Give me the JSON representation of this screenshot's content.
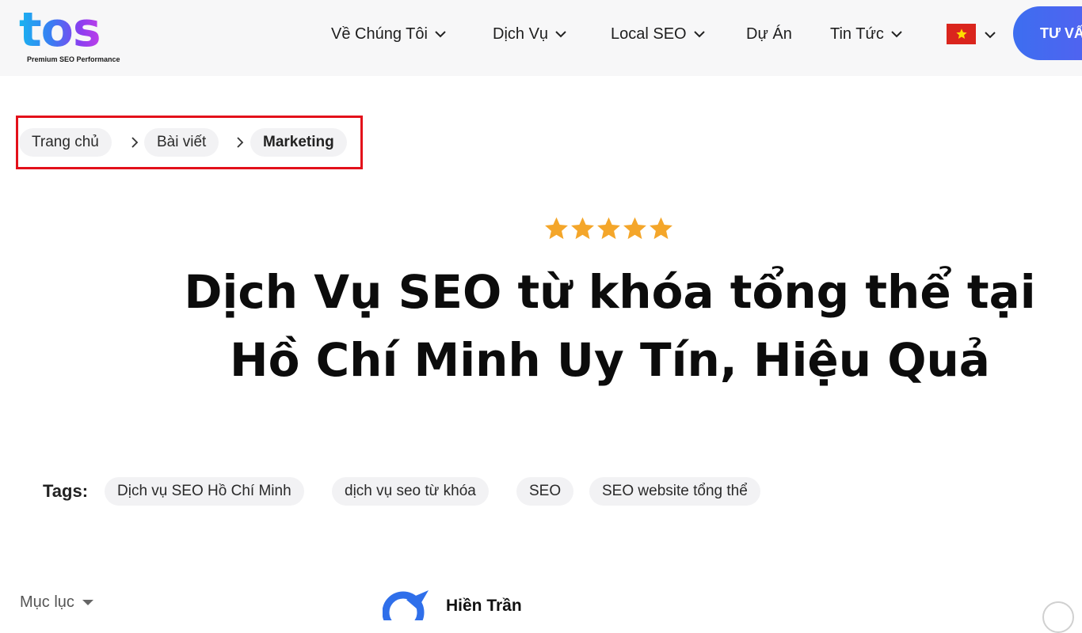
{
  "header": {
    "logo_text": "tos",
    "logo_tagline": "Premium SEO Performance",
    "nav": [
      {
        "label": "Về Chúng Tôi",
        "has_dropdown": true
      },
      {
        "label": "Dịch Vụ",
        "has_dropdown": true
      },
      {
        "label": "Local SEO",
        "has_dropdown": true
      },
      {
        "label": "Dự Án",
        "has_dropdown": false
      },
      {
        "label": "Tin Tức",
        "has_dropdown": true
      }
    ],
    "language_flag": "vietnam-flag-icon",
    "cta_label": "TƯ VẤ"
  },
  "breadcrumb": {
    "items": [
      "Trang chủ",
      "Bài viết",
      "Marketing"
    ],
    "current": "Marketing",
    "highlight_color": "#e3101a"
  },
  "rating": {
    "stars": 5,
    "max": 5,
    "color": "#f4a62a"
  },
  "article": {
    "title_line_1": "Dịch Vụ SEO từ khóa tổng thể tại",
    "title_line_2": "Hồ Chí Minh Uy Tín, Hiệu Quả"
  },
  "tags": {
    "label": "Tags:",
    "items": [
      "Dịch vụ SEO Hồ Chí Minh",
      "dịch vụ seo từ khóa",
      "SEO",
      "SEO website tổng thể"
    ]
  },
  "toc": {
    "label": "Mục lục"
  },
  "author": {
    "name": "Hiền Trần"
  },
  "colors": {
    "header_bg": "#f7f7f8",
    "cta_start": "#3d6ef0",
    "cta_end": "#5a5df0",
    "pill_bg": "#f2f2f4",
    "flag_red": "#da251d",
    "flag_star": "#ffde00"
  }
}
